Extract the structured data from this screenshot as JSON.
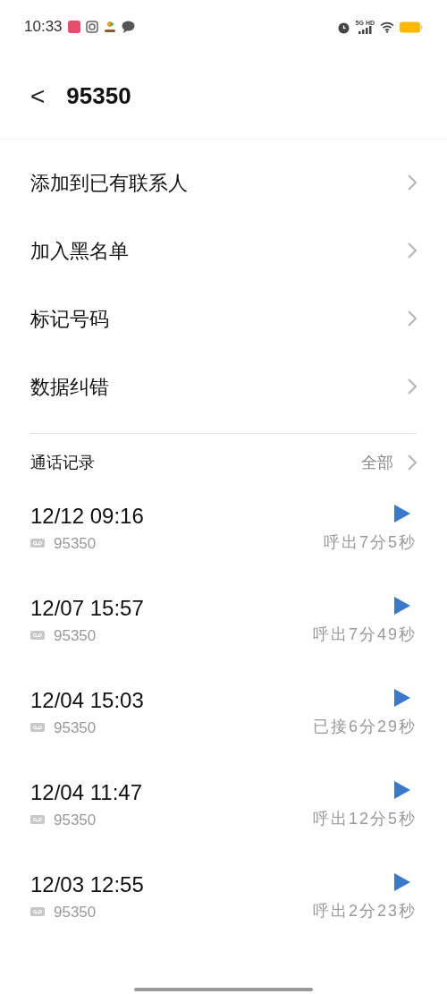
{
  "status_bar": {
    "time": "10:33",
    "network": "5G HD"
  },
  "header": {
    "back": "<",
    "title": "95350"
  },
  "menu": [
    {
      "label": "添加到已有联系人"
    },
    {
      "label": "加入黑名单"
    },
    {
      "label": "标记号码"
    },
    {
      "label": "数据纠错"
    }
  ],
  "call_log": {
    "title": "通话记录",
    "all": "全部",
    "rows": [
      {
        "time": "12/12 09:16",
        "number": "95350",
        "detail": "呼出7分5秒"
      },
      {
        "time": "12/07 15:57",
        "number": "95350",
        "detail": "呼出7分49秒"
      },
      {
        "time": "12/04 15:03",
        "number": "95350",
        "detail": "已接6分29秒"
      },
      {
        "time": "12/04 11:47",
        "number": "95350",
        "detail": "呼出12分5秒"
      },
      {
        "time": "12/03 12:55",
        "number": "95350",
        "detail": "呼出2分23秒"
      }
    ]
  }
}
